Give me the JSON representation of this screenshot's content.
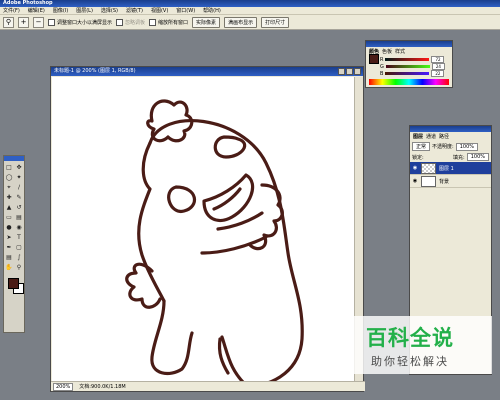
{
  "window": {
    "title": "Adobe Photoshop"
  },
  "menu": [
    "文件(F)",
    "编辑(E)",
    "图像(I)",
    "图层(L)",
    "选择(S)",
    "滤镜(T)",
    "视图(V)",
    "窗口(W)",
    "帮助(H)"
  ],
  "options": {
    "resize_windows": "调整窗口大小以满屏显示",
    "ignore_palettes": "忽略调板",
    "zoom_all": "缩放所有窗口",
    "actual_pixels": "实际像素",
    "fit_on_screen": "满画布显示",
    "print_size": "打印尺寸"
  },
  "document": {
    "title": "未标题-1 @ 200% (图层 1, RGB/8)",
    "zoom": "200%",
    "doc_info": "文档:900.0K/1.18M"
  },
  "color_panel": {
    "tabs": [
      "颜色",
      "色板",
      "样式"
    ],
    "channels": [
      {
        "label": "R",
        "value": "72"
      },
      {
        "label": "G",
        "value": "24"
      },
      {
        "label": "B",
        "value": "22"
      }
    ]
  },
  "layers_panel": {
    "tabs": [
      "图层",
      "通道",
      "路径"
    ],
    "blend_mode": "正常",
    "opacity_label": "不透明度:",
    "opacity": "100%",
    "lock_label": "锁定:",
    "fill_label": "填充:",
    "fill": "100%",
    "layers": [
      {
        "name": "图层 1",
        "selected": true
      },
      {
        "name": "背景",
        "selected": false
      }
    ]
  },
  "watermark": {
    "main": "百科全说",
    "sub": "助你轻松解决"
  },
  "colors": {
    "foreground": "#4a1c16",
    "stroke": "#4a1c16",
    "title_bar": "#1f3f9c",
    "watermark_green": "#23b04a"
  }
}
